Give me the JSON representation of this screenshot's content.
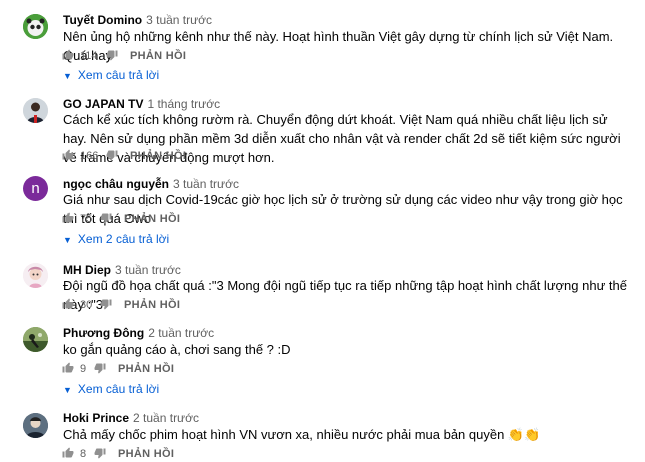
{
  "comments": [
    {
      "author": "Tuyết Domino",
      "time": "3 tuần trước",
      "text": "Nên ủng hộ những kênh như thế này. Hoạt hình thuần Việt gây dựng từ chính lịch sử Việt Nam. Quá hay",
      "likes": "114",
      "reply_label": "PHẢN HỒI",
      "view_replies": "Xem câu trả lời"
    },
    {
      "author": "GO JAPAN TV",
      "time": "1 tháng trước",
      "text": "Cách kể xúc tích không rườm rà. Chuyển động dứt khoát. Việt Nam quá nhiều chất liệu lịch sử hay. Nên sử dụng phần mềm 3d diễn xuất cho nhân vật và render chất 2d sẽ tiết kiệm sức người vẽ frame và chuyển động mượt hơn.",
      "likes": "166",
      "reply_label": "PHẢN HỒI"
    },
    {
      "author": "ngọc châu nguyễn",
      "time": "3 tuần trước",
      "avatar_letter": "n",
      "text": "Giá như sau dịch Covid-19các giờ học lịch sử ở trường sử dụng các video như vậy trong giờ học thì tốt quá Owo",
      "likes": "75",
      "reply_label": "PHẢN HỒI",
      "view_replies": "Xem 2 câu trả lời"
    },
    {
      "author": "MH Diep",
      "time": "3 tuần trước",
      "text": "Đội ngũ đồ họa chất quá :\"3 Mong đội ngũ tiếp tục ra tiếp những tập hoạt hình chất lượng như thế này :\"3",
      "likes": "30",
      "reply_label": "PHẢN HỒI"
    },
    {
      "author": "Phương Đông",
      "time": "2 tuần trước",
      "text": "ko gắn quảng cáo à, chơi sang thế ? :D",
      "likes": "9",
      "reply_label": "PHẢN HỒI",
      "view_replies": "Xem câu trả lời"
    },
    {
      "author": "Hoki Prince",
      "time": "2 tuần trước",
      "text": "Chả mấy chốc phim hoạt hình VN vươn xa,  nhiều nước phải mua bản quyền 👏👏",
      "likes": "8",
      "reply_label": "PHẢN HỒI"
    }
  ],
  "icons": {
    "like": "thumbs-up-icon",
    "dislike": "thumbs-down-icon",
    "expand": "caret-down-icon"
  },
  "colors": {
    "link": "#065fd4",
    "secondary": "#606060",
    "avatar_n": "#7b2a9a"
  }
}
